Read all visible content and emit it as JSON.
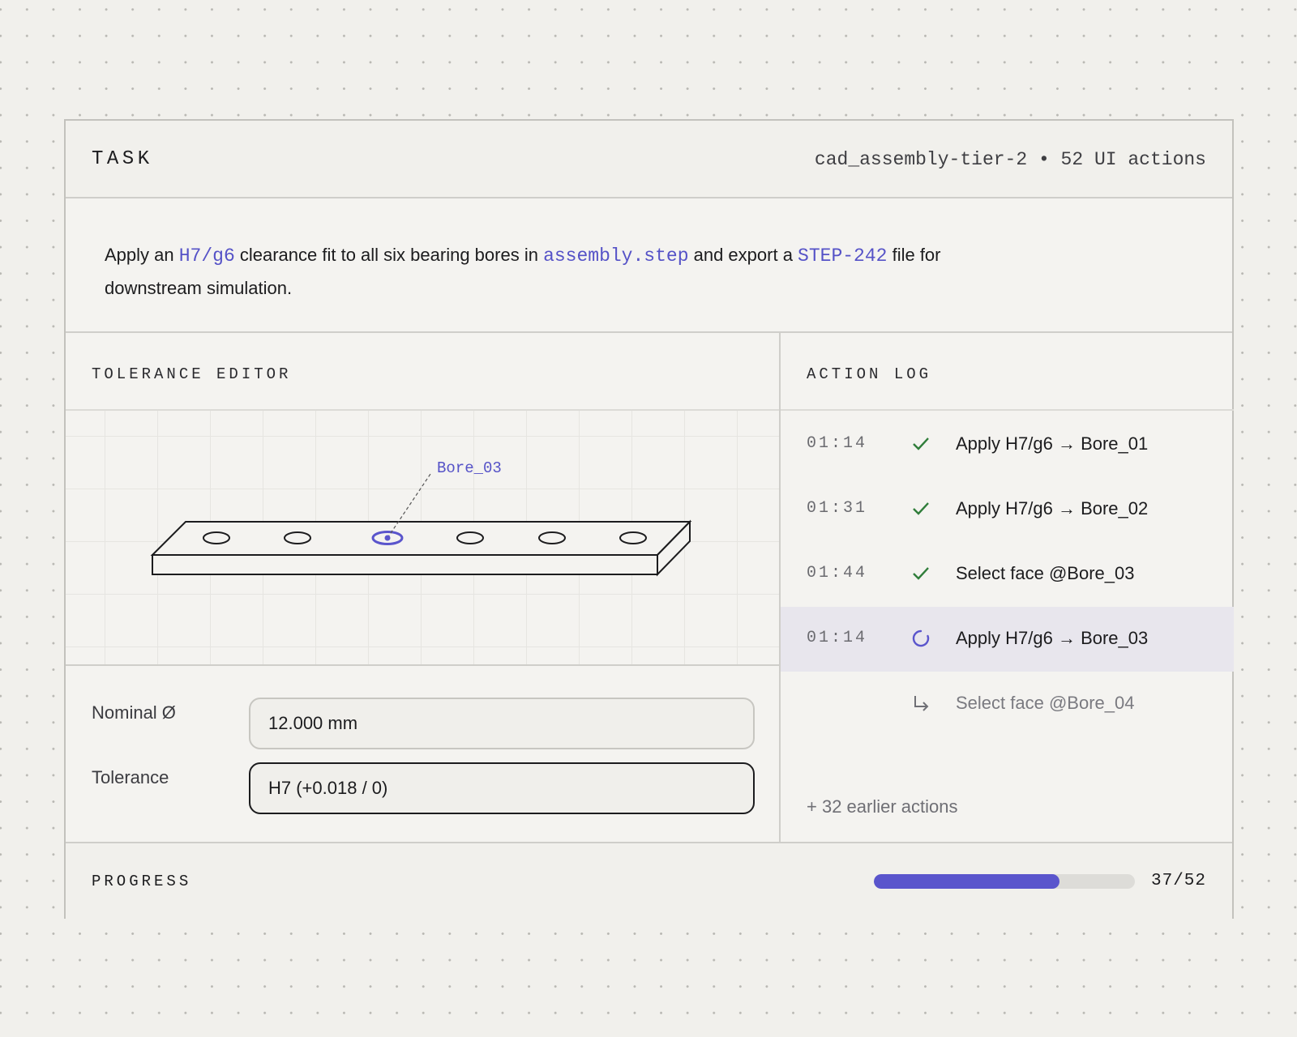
{
  "header": {
    "label": "TASK",
    "meta": "cad_assembly-tier-2 • 52 UI actions"
  },
  "description": {
    "t1": "Apply an ",
    "c1": "H7/g6",
    "t2": " clearance fit to all six bearing bores in ",
    "c2": "assembly.step",
    "t3": " and export a ",
    "c3": "STEP-242",
    "t4": " file for downstream simulation."
  },
  "editor": {
    "title": "TOLERANCE EDITOR",
    "callout": "Bore_03",
    "nominal_label": "Nominal Ø",
    "nominal_value": "12.000 mm",
    "tolerance_label": "Tolerance",
    "tolerance_value": "H7 (+0.018 / 0)"
  },
  "log": {
    "title": "ACTION LOG",
    "items": [
      {
        "time": "01:14",
        "status": "done",
        "icon": "check-icon",
        "text": "Apply H7/g6 → Bore_01"
      },
      {
        "time": "01:31",
        "status": "done",
        "icon": "check-icon",
        "text": "Apply H7/g6 → Bore_02"
      },
      {
        "time": "01:44",
        "status": "done",
        "icon": "check-icon",
        "text": "Select face @Bore_03"
      },
      {
        "time": "01:14",
        "status": "running",
        "icon": "spinner-icon",
        "text": "Apply H7/g6 → Bore_03"
      },
      {
        "time": "",
        "status": "next",
        "icon": "return-arrow-icon",
        "text": "Select face @Bore_04"
      }
    ],
    "earlier": "+ 32 earlier actions"
  },
  "progress": {
    "label": "PROGRESS",
    "done": 37,
    "total": 52,
    "count_text": "37/52"
  },
  "colors": {
    "accent": "#5a55cc",
    "check": "#2f7d3a",
    "ink": "#1c1c1e"
  }
}
